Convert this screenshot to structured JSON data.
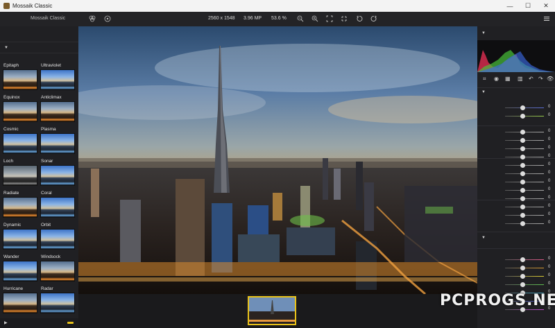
{
  "window": {
    "title": "Mossaik Classic",
    "minimize": "—",
    "maximize": "☐",
    "close": "✕"
  },
  "toolbar": {
    "app_name": "Mossaik Classic",
    "resolution": "2560 x 1548",
    "megapixels": "3.96 MP",
    "zoom": "53.6 %",
    "icons": [
      "color-channels-icon",
      "help-icon",
      "zoom-out-icon",
      "zoom-in-icon",
      "fit-screen-icon",
      "actual-size-icon",
      "rotate-left-icon",
      "rotate-right-icon",
      "menu-icon"
    ]
  },
  "presets": [
    {
      "label": "Epitaph",
      "style": "warm"
    },
    {
      "label": "Ultraviolet",
      "style": "bluish"
    },
    {
      "label": "Equinox",
      "style": "warm"
    },
    {
      "label": "Anticlimax",
      "style": "warm"
    },
    {
      "label": "Cosmic",
      "style": "bluish"
    },
    {
      "label": "Plasma",
      "style": "bluish"
    },
    {
      "label": "Loch",
      "style": "gray"
    },
    {
      "label": "Sonar",
      "style": "bluish"
    },
    {
      "label": "Radiate",
      "style": "warm"
    },
    {
      "label": "Coral",
      "style": "bluish"
    },
    {
      "label": "Dynamic",
      "style": "bluish"
    },
    {
      "label": "Orbit",
      "style": "bluish"
    },
    {
      "label": "Wander",
      "style": "bluish"
    },
    {
      "label": "Windsock",
      "style": "warm"
    },
    {
      "label": "Hurricane",
      "style": "warm"
    },
    {
      "label": "Radar",
      "style": "bluish"
    }
  ],
  "adjustments": {
    "group1": [
      {
        "value": "0",
        "pos": 0.45
      },
      {
        "value": "0",
        "pos": 0.45
      }
    ],
    "group2": [
      {
        "value": "0",
        "pos": 0.45
      },
      {
        "value": "0",
        "pos": 0.45
      },
      {
        "value": "0",
        "pos": 0.45
      },
      {
        "value": "0",
        "pos": 0.45
      }
    ],
    "group3": [
      {
        "value": "0",
        "pos": 0.45
      },
      {
        "value": "0",
        "pos": 0.45
      },
      {
        "value": "0",
        "pos": 0.45
      },
      {
        "value": "0",
        "pos": 0.45
      },
      {
        "value": "0",
        "pos": 0.45
      }
    ],
    "group4": [
      {
        "value": "0",
        "pos": 0.45
      },
      {
        "value": "0",
        "pos": 0.45
      },
      {
        "value": "0",
        "pos": 0.45
      }
    ],
    "group5": [
      {
        "value": "0",
        "pos": 0.45
      },
      {
        "value": "0",
        "pos": 0.45
      },
      {
        "value": "0",
        "pos": 0.45
      },
      {
        "value": "0",
        "pos": 0.45
      },
      {
        "value": "0",
        "pos": 0.45
      },
      {
        "value": "0",
        "pos": 0.45
      },
      {
        "value": "0",
        "pos": 0.45
      }
    ]
  },
  "watermark": "PCPROGS.NET",
  "colors": {
    "accent": "#e8c21a"
  }
}
